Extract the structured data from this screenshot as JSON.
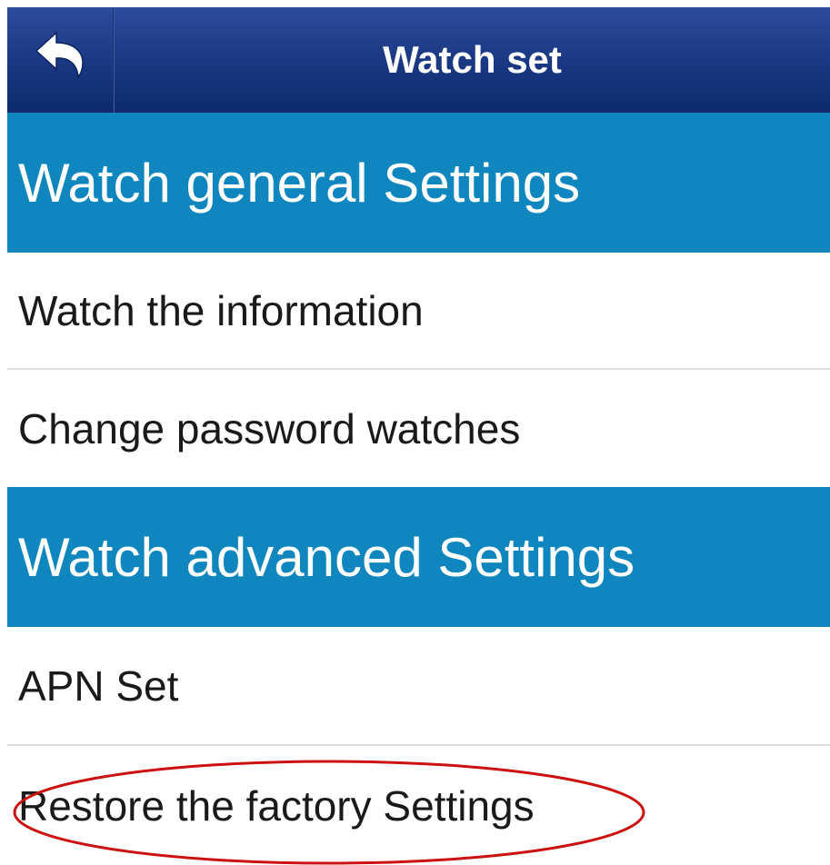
{
  "header": {
    "title": "Watch set",
    "back_icon": "back-arrow-icon",
    "colors": {
      "top": "#2e4c9c",
      "bottom": "#0e2a6e"
    }
  },
  "sections": [
    {
      "title": "Watch general Settings",
      "items": [
        {
          "label": "Watch the information"
        },
        {
          "label": "Change password watches"
        }
      ]
    },
    {
      "title": "Watch advanced Settings",
      "items": [
        {
          "label": "APN Set"
        },
        {
          "label": "Restore the factory Settings"
        }
      ]
    }
  ],
  "colors": {
    "section_header": "#0f86bd",
    "annotation_circle": "#cc1111"
  }
}
